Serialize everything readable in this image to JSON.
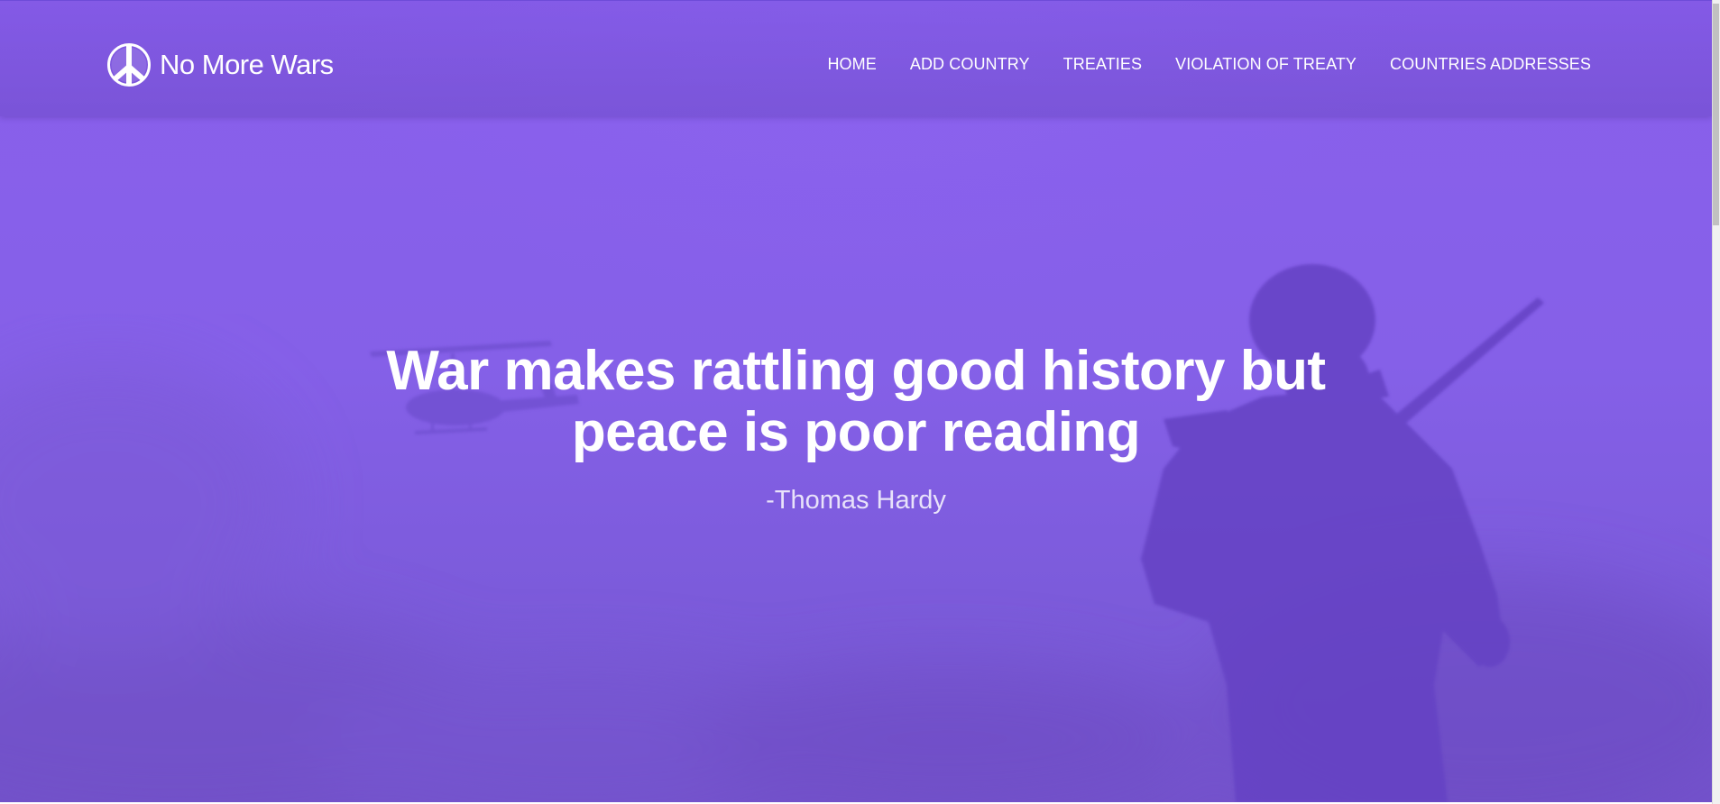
{
  "brand": {
    "name": "No More Wars",
    "logo_icon": "peace-sign-icon"
  },
  "nav": {
    "items": [
      {
        "label": "HOME"
      },
      {
        "label": "ADD COUNTRY"
      },
      {
        "label": "TREATIES"
      },
      {
        "label": "VIOLATION OF TREATY"
      },
      {
        "label": "COUNTRIES ADDRESSES"
      }
    ]
  },
  "hero": {
    "quote_line1": "War makes rattling good history but",
    "quote_line2": "peace is poor reading",
    "author": "-Thomas Hardy"
  },
  "colors": {
    "hero_purple": "#8560e8",
    "silhouette": "#6a48c8",
    "text": "#ffffff"
  },
  "icons": [
    "peace-sign-icon",
    "helicopter-silhouette",
    "soldier-silhouette"
  ]
}
